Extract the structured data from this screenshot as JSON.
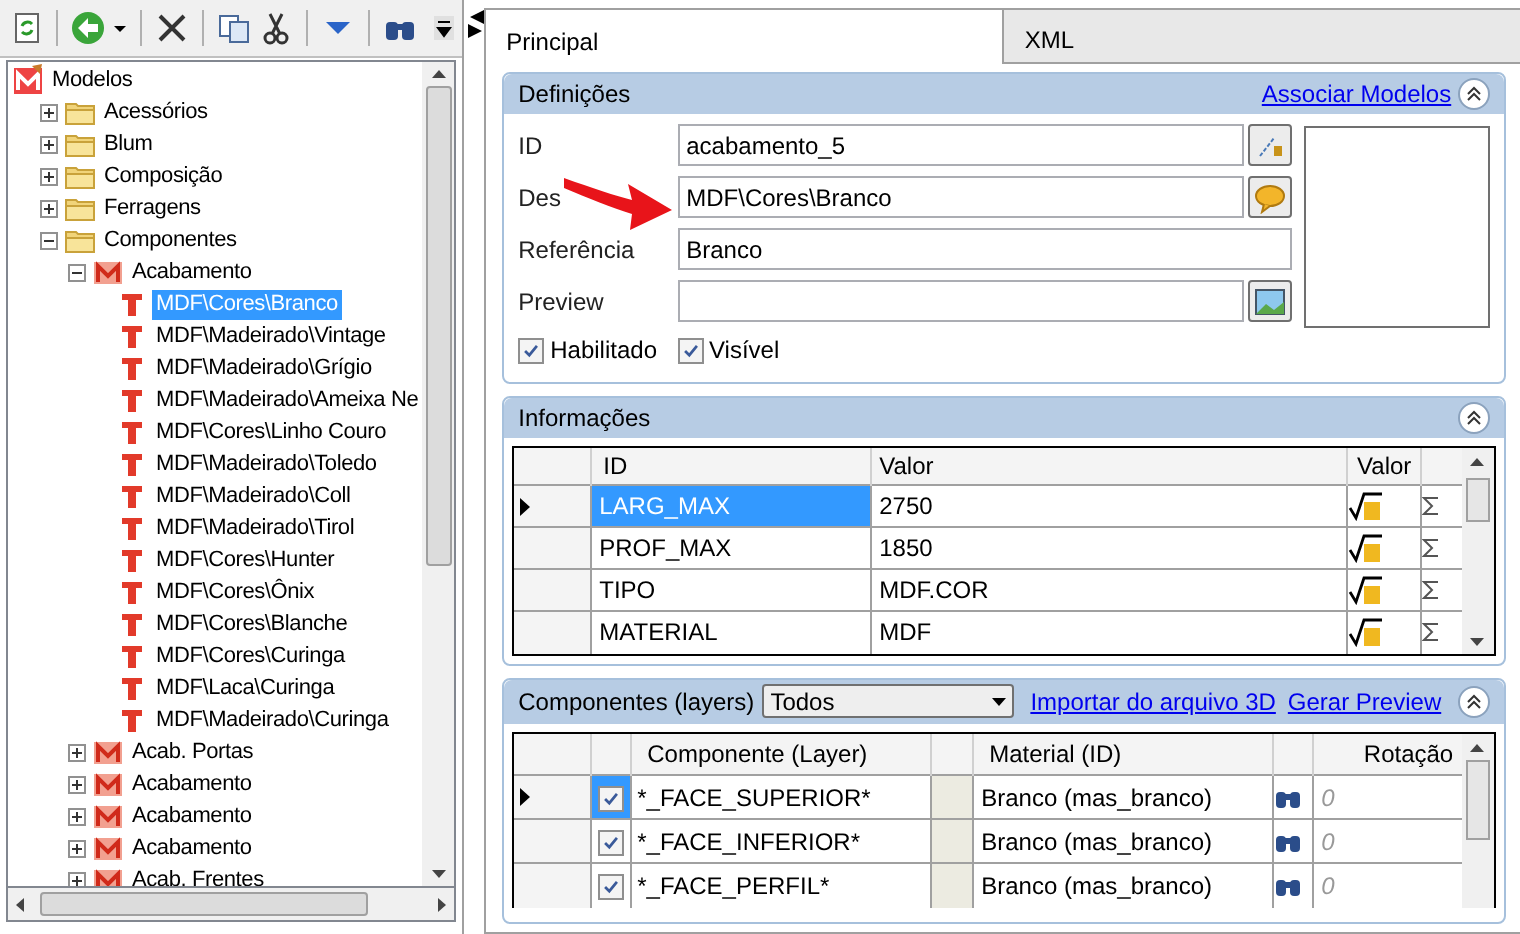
{
  "tree": {
    "label": "Modelos",
    "kind": "root",
    "children": [
      {
        "label": "Acessórios",
        "kind": "folder",
        "expanded": false
      },
      {
        "label": "Blum",
        "kind": "folder",
        "expanded": false
      },
      {
        "label": "Composição",
        "kind": "folder",
        "expanded": false
      },
      {
        "label": "Ferragens",
        "kind": "folder",
        "expanded": false
      },
      {
        "label": "Componentes",
        "kind": "folder",
        "expanded": true,
        "children": [
          {
            "label": "Acabamento",
            "kind": "model",
            "expanded": true,
            "children": [
              {
                "label": "MDF\\Cores\\Branco",
                "kind": "texture",
                "selected": true
              },
              {
                "label": "MDF\\Madeirado\\Vintage",
                "kind": "texture",
                "selected": false
              },
              {
                "label": "MDF\\Madeirado\\Grígio",
                "kind": "texture",
                "selected": false
              },
              {
                "label": "MDF\\Madeirado\\Ameixa Ne",
                "kind": "texture",
                "selected": false
              },
              {
                "label": "MDF\\Cores\\Linho Couro",
                "kind": "texture",
                "selected": false
              },
              {
                "label": "MDF\\Madeirado\\Toledo",
                "kind": "texture",
                "selected": false
              },
              {
                "label": "MDF\\Madeirado\\Coll",
                "kind": "texture",
                "selected": false
              },
              {
                "label": "MDF\\Madeirado\\Tirol",
                "kind": "texture",
                "selected": false
              },
              {
                "label": "MDF\\Cores\\Hunter",
                "kind": "texture",
                "selected": false
              },
              {
                "label": "MDF\\Cores\\Ônix",
                "kind": "texture",
                "selected": false
              },
              {
                "label": "MDF\\Cores\\Blanche",
                "kind": "texture",
                "selected": false
              },
              {
                "label": "MDF\\Cores\\Curinga",
                "kind": "texture",
                "selected": false
              },
              {
                "label": "MDF\\Laca\\Curinga",
                "kind": "texture",
                "selected": false
              },
              {
                "label": "MDF\\Madeirado\\Curinga",
                "kind": "texture",
                "selected": false
              }
            ]
          },
          {
            "label": "Acab. Portas",
            "kind": "model",
            "expanded": false
          },
          {
            "label": "Acabamento",
            "kind": "model",
            "expanded": false
          },
          {
            "label": "Acabamento",
            "kind": "model",
            "expanded": false
          },
          {
            "label": "Acabamento",
            "kind": "model",
            "expanded": false
          },
          {
            "label": "Acab. Frentes",
            "kind": "model",
            "expanded": false
          }
        ]
      }
    ]
  },
  "tabs": [
    {
      "label": "Principal",
      "selected": true
    },
    {
      "label": "XML",
      "selected": false
    }
  ],
  "definicoes": {
    "title": "Definições",
    "link": "Associar Modelos",
    "fields": [
      {
        "label": "ID",
        "value": "acabamento_5",
        "kind": "lookup"
      },
      {
        "label": "Des",
        "value": "MDF\\Cores\\Branco",
        "kind": "comment"
      },
      {
        "label": "Referência",
        "value": "Branco",
        "kind": "plain"
      },
      {
        "label": "Preview",
        "kind": "image"
      }
    ],
    "checkboxes": [
      {
        "label": "Habilitado",
        "checked": true
      },
      {
        "label": "Visível",
        "checked": true
      }
    ]
  },
  "informacoes": {
    "title": "Informações",
    "columns": [
      "ID",
      "Valor",
      "Valor"
    ],
    "rows": [
      {
        "id": "LARG_MAX",
        "value": "2750",
        "selected": true
      },
      {
        "id": "PROF_MAX",
        "value": "1850",
        "selected": false
      },
      {
        "id": "TIPO",
        "value": "MDF.COR",
        "selected": false
      },
      {
        "id": "MATERIAL",
        "value": "MDF",
        "selected": false
      }
    ]
  },
  "componentes": {
    "title": "Componentes (layers)",
    "filter": "Todos",
    "links": [
      "Importar do arquivo 3D",
      "Gerar Preview"
    ],
    "columns": [
      "Componente (Layer)",
      "Material (ID)",
      "Rotação"
    ],
    "rows": [
      {
        "checked": true,
        "layer": "*_FACE_SUPERIOR*",
        "material": "Branco (mas_branco)",
        "rotation": "0",
        "selected": true
      },
      {
        "checked": true,
        "layer": "*_FACE_INFERIOR*",
        "material": "Branco (mas_branco)",
        "rotation": "0",
        "selected": false
      },
      {
        "checked": true,
        "layer": "*_FACE_PERFIL*",
        "material": "Branco (mas_branco)",
        "rotation": "0",
        "selected": false
      }
    ]
  }
}
